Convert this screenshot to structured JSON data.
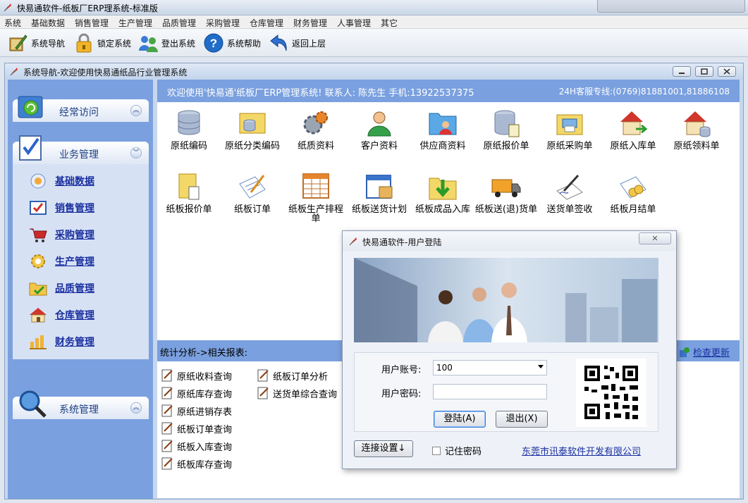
{
  "app": {
    "title": "快易通软件-纸板厂ERP理系统-标准版"
  },
  "menu": [
    "系统",
    "基础数据",
    "销售管理",
    "生产管理",
    "品质管理",
    "采购管理",
    "仓库管理",
    "财务管理",
    "人事管理",
    "其它"
  ],
  "toolbar": {
    "nav": "系统导航",
    "lock": "锁定系统",
    "logout": "登出系统",
    "help": "系统帮助",
    "back": "返回上层"
  },
  "child_window": {
    "title": "系统导航-欢迎使用快易通纸品行业管理系统"
  },
  "sidebar": {
    "frequent": "经常访问",
    "business": "业务管理",
    "system": "系统管理",
    "items": [
      "基础数据",
      "销售管理",
      "采购管理",
      "生产管理",
      "品质管理",
      "仓库管理",
      "财务管理"
    ]
  },
  "welcome": {
    "left": "欢迎使用'快易通'纸板厂ERP管理系统! 联系人: 陈先生 手机:13922537375",
    "right": "24H客服专线:(0769)81881001,81886108"
  },
  "modules_row1": [
    "原纸编码",
    "原纸分类编码",
    "纸质资料",
    "客户资料",
    "供应商资料",
    "原纸报价单",
    "原纸采购单",
    "原纸入库单",
    "原纸领料单"
  ],
  "modules_row2": [
    "纸板报价单",
    "纸板订单",
    "纸板生产排程单",
    "纸板送货计划",
    "纸板成品入库",
    "纸板送(退)货单",
    "送货单签收",
    "纸板月结单"
  ],
  "reports": {
    "title": "统计分析->相关报表:",
    "update": "检查更新",
    "col1": [
      "原纸收料查询",
      "原纸库存查询",
      "原纸进销存表",
      "纸板订单查询",
      "纸板入库查询",
      "纸板库存查询"
    ],
    "col2": [
      "纸板订单分析",
      "送货单综合查询"
    ]
  },
  "login_dialog": {
    "title": "快易通软件-用户登陆",
    "account_label": "用户账号:",
    "account_value": "100",
    "password_label": "用户密码:",
    "password_value": "",
    "login_btn": "登陆(A)",
    "exit_btn": "退出(X)",
    "connect_btn": "连接设置↓",
    "remember": "记住密码",
    "company": "东莞市讯泰软件开发有限公司",
    "close_glyph": "✕"
  },
  "colors": {
    "panel_blue": "#7aa0df",
    "link_blue": "#1a2fa0"
  }
}
